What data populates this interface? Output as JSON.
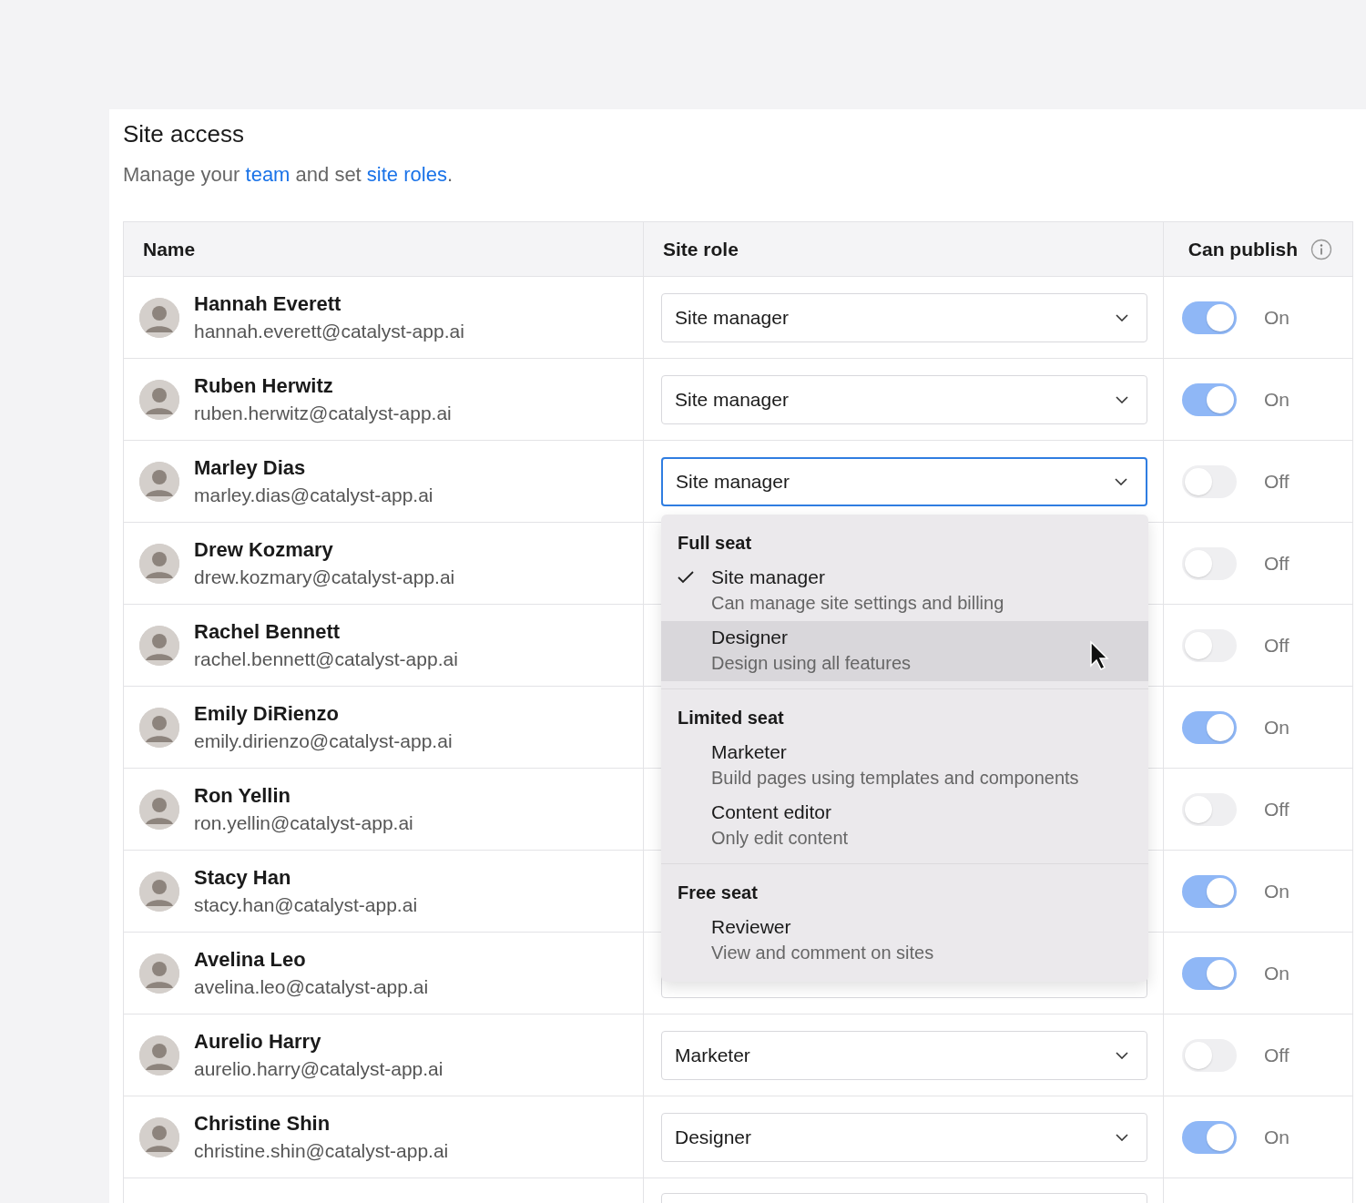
{
  "title": "Site access",
  "subtitle_parts": [
    {
      "text": "Manage your ",
      "kind": "text"
    },
    {
      "text": "team",
      "kind": "link"
    },
    {
      "text": " and set ",
      "kind": "text"
    },
    {
      "text": "site roles",
      "kind": "link"
    },
    {
      "text": ".",
      "kind": "text"
    }
  ],
  "table": {
    "columns": [
      "Name",
      "Site role",
      "Can publish"
    ],
    "rows": [
      {
        "name": "Hannah Everett",
        "email": "hannah.everett@catalyst-app.ai",
        "role": "Site manager",
        "open": false,
        "publish": {
          "on": true,
          "label": "On"
        }
      },
      {
        "name": "Ruben Herwitz",
        "email": "ruben.herwitz@catalyst-app.ai",
        "role": "Site manager",
        "open": false,
        "publish": {
          "on": true,
          "label": "On"
        }
      },
      {
        "name": "Marley Dias",
        "email": "marley.dias@catalyst-app.ai",
        "role": "Site manager",
        "open": true,
        "publish": {
          "on": false,
          "label": "Off"
        }
      },
      {
        "name": "Drew Kozmary",
        "email": "drew.kozmary@catalyst-app.ai",
        "publish": {
          "on": false,
          "label": "Off"
        }
      },
      {
        "name": "Rachel Bennett",
        "email": "rachel.bennett@catalyst-app.ai",
        "publish": {
          "on": false,
          "label": "Off"
        }
      },
      {
        "name": "Emily DiRienzo",
        "email": "emily.dirienzo@catalyst-app.ai",
        "publish": {
          "on": true,
          "label": "On"
        }
      },
      {
        "name": "Ron Yellin",
        "email": "ron.yellin@catalyst-app.ai",
        "publish": {
          "on": false,
          "label": "Off"
        }
      },
      {
        "name": "Stacy Han",
        "email": "stacy.han@catalyst-app.ai",
        "publish": {
          "on": true,
          "label": "On"
        }
      },
      {
        "name": "Avelina Leo",
        "email": "avelina.leo@catalyst-app.ai",
        "publish": {
          "on": true,
          "label": "On"
        }
      },
      {
        "name": "Aurelio Harry",
        "email": "aurelio.harry@catalyst-app.ai",
        "role": "Marketer",
        "open": false,
        "publish": {
          "on": false,
          "label": "Off"
        }
      },
      {
        "name": "Christine Shin",
        "email": "christine.shin@catalyst-app.ai",
        "role": "Designer",
        "open": false,
        "publish": {
          "on": true,
          "label": "On"
        }
      }
    ]
  },
  "role_menu": {
    "groups": [
      {
        "title": "Full seat",
        "items": [
          {
            "label": "Site manager",
            "description": "Can manage site settings and billing",
            "selected": true,
            "highlighted": false
          },
          {
            "label": "Designer",
            "description": "Design using all features",
            "selected": false,
            "highlighted": true
          }
        ]
      },
      {
        "title": "Limited seat",
        "items": [
          {
            "label": "Marketer",
            "description": "Build pages using templates and components",
            "selected": false,
            "highlighted": false
          },
          {
            "label": "Content editor",
            "description": "Only edit content",
            "selected": false,
            "highlighted": false
          }
        ]
      },
      {
        "title": "Free seat",
        "items": [
          {
            "label": "Reviewer",
            "description": "View and comment on sites",
            "selected": false,
            "highlighted": false
          }
        ]
      }
    ]
  }
}
